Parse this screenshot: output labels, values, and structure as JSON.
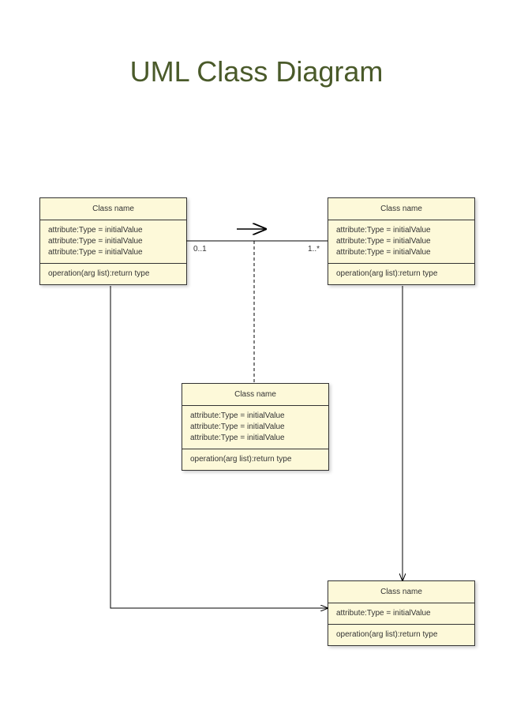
{
  "title": "UML Class Diagram",
  "classes": {
    "topLeft": {
      "name": "Class name",
      "attributes": [
        "attribute:Type = initialValue",
        "attribute:Type = initialValue",
        "attribute:Type = initialValue"
      ],
      "operations": [
        "operation(arg list):return type"
      ]
    },
    "topRight": {
      "name": "Class name",
      "attributes": [
        "attribute:Type = initialValue",
        "attribute:Type = initialValue",
        "attribute:Type = initialValue"
      ],
      "operations": [
        "operation(arg list):return type"
      ]
    },
    "middle": {
      "name": "Class name",
      "attributes": [
        "attribute:Type = initialValue",
        "attribute:Type = initialValue",
        "attribute:Type = initialValue"
      ],
      "operations": [
        "operation(arg list):return type"
      ]
    },
    "bottom": {
      "name": "Class name",
      "attributes": [
        "attribute:Type = initialValue"
      ],
      "operations": [
        "operation(arg list):return type"
      ]
    }
  },
  "multiplicities": {
    "left": "0..1",
    "right": "1..*"
  }
}
